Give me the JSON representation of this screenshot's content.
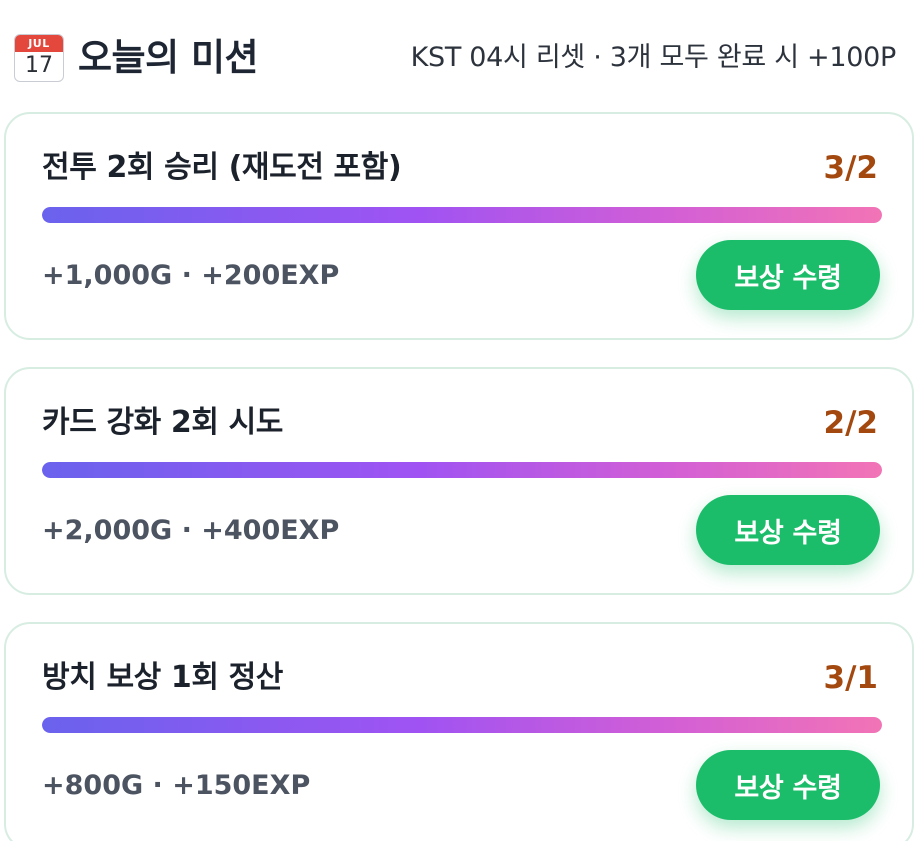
{
  "header": {
    "icon": "calendar-icon",
    "icon_month": "JUL",
    "icon_day": "17",
    "title": "오늘의 미션",
    "reset_info": "KST 04시 리셋 · 3개 모두 완료 시 +100P"
  },
  "colors": {
    "progress_text": "#a3480f",
    "claim_button": "#1cbd6a",
    "bar_gradient_start": "#6a62ee",
    "bar_gradient_end": "#f274b6"
  },
  "missions": [
    {
      "name": "전투 2회 승리 (재도전 포함)",
      "progress": "3/2",
      "fill_fraction": 1.0,
      "reward": "+1,000G · +200EXP",
      "button_label": "보상 수령"
    },
    {
      "name": "카드 강화 2회 시도",
      "progress": "2/2",
      "fill_fraction": 1.0,
      "reward": "+2,000G · +400EXP",
      "button_label": "보상 수령"
    },
    {
      "name": "방치 보상 1회 정산",
      "progress": "3/1",
      "fill_fraction": 1.0,
      "reward": "+800G · +150EXP",
      "button_label": "보상 수령"
    }
  ]
}
